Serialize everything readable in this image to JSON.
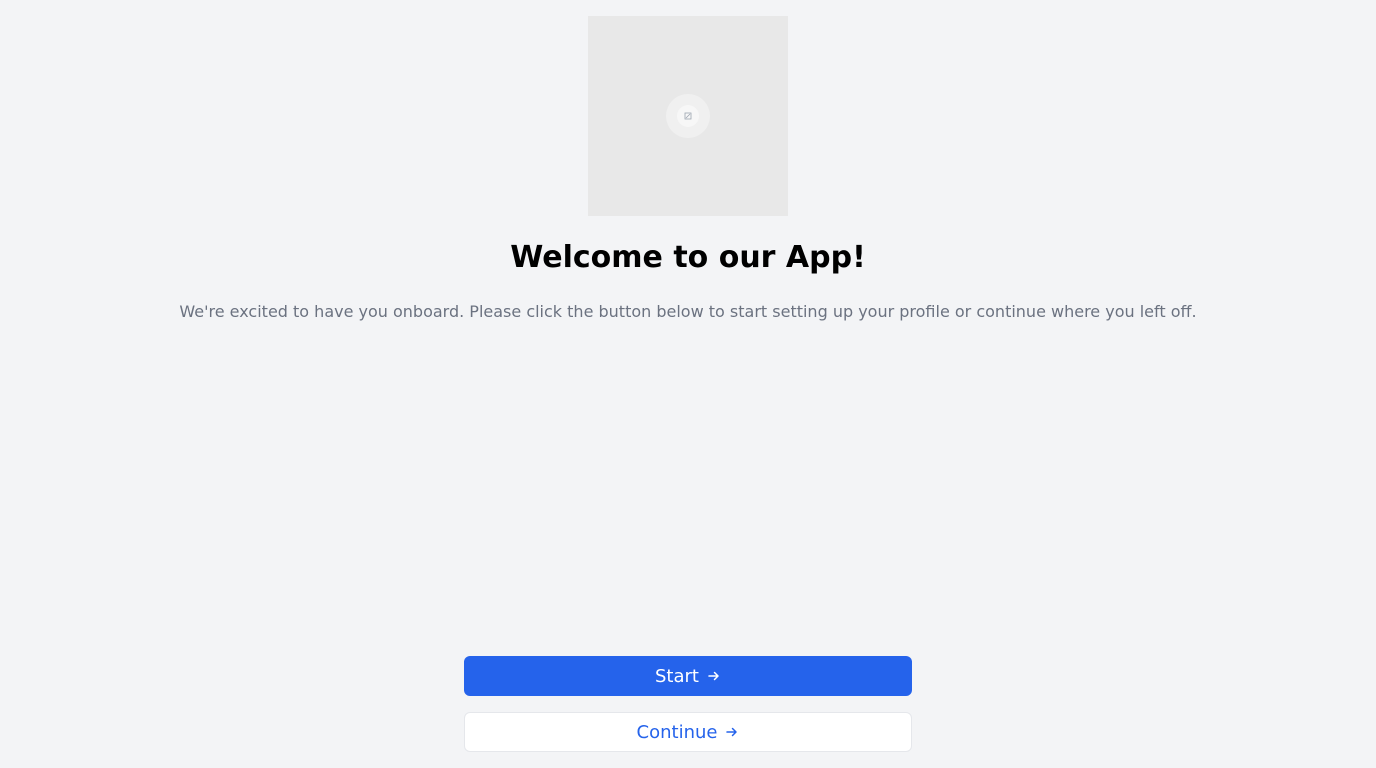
{
  "hero": {
    "image_icon": "image-placeholder-icon"
  },
  "welcome": {
    "title": "Welcome to our App!",
    "subtitle": "We're excited to have you onboard. Please click the button below to start setting up your profile or continue where you left off."
  },
  "actions": {
    "start_label": "Start",
    "continue_label": "Continue",
    "arrow_icon": "arrow-right-icon"
  },
  "colors": {
    "background": "#f3f4f6",
    "primary": "#2563eb",
    "subtitle": "#6b7280",
    "image_bg": "#e8e8e8"
  }
}
